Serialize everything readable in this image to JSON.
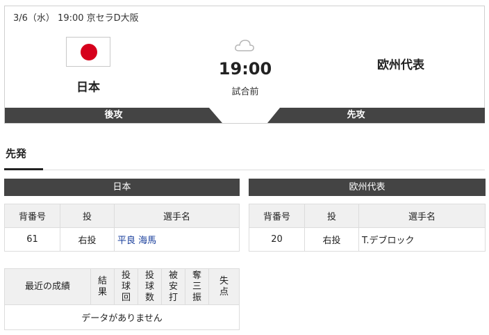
{
  "game": {
    "date_venue": "3/6（水） 19:00 京セラD大阪",
    "home_team": "日本",
    "away_team": "欧州代表",
    "time": "19:00",
    "status": "試合前",
    "home_side": "後攻",
    "away_side": "先攻",
    "weather_icon": "cloud-icon"
  },
  "section": {
    "title": "先発"
  },
  "starters": {
    "columns": [
      "背番号",
      "投",
      "選手名"
    ],
    "home": {
      "team": "日本",
      "number": "61",
      "throws": "右投",
      "name": "平良 海馬"
    },
    "away": {
      "team": "欧州代表",
      "number": "20",
      "throws": "右投",
      "name": "T.デブロック"
    }
  },
  "recent": {
    "columns": [
      "最近の成績",
      "結果",
      "投球回",
      "投球数",
      "被安打",
      "奪三振",
      "失点"
    ],
    "empty_message": "データがありません"
  },
  "colors": {
    "bar": "#444444",
    "flag_red": "#d6001c",
    "link": "#1a3f9c"
  }
}
